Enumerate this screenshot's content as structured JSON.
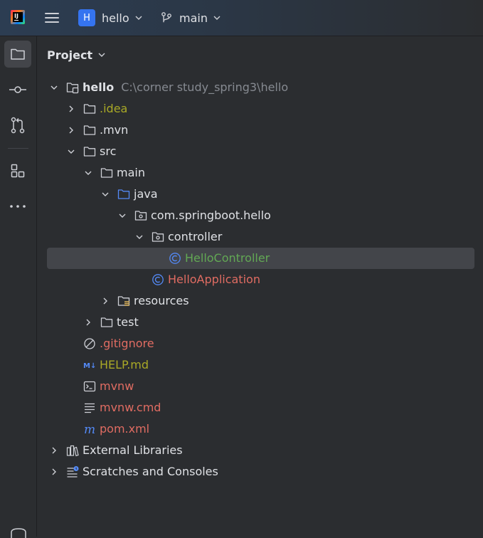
{
  "titlebar": {
    "logo_text": "IJ",
    "project_initial": "H",
    "project_name": "hello",
    "branch": "main",
    "accent": "#3574f0"
  },
  "toolstrip": {
    "items": [
      {
        "icon": "folder-icon",
        "label": "Project",
        "active": true
      },
      {
        "icon": "commit-icon",
        "label": "Commit"
      },
      {
        "icon": "pull-requests-icon",
        "label": "Pull Requests"
      },
      {
        "icon": "structure-icon",
        "label": "Structure"
      },
      {
        "icon": "more-icon",
        "label": "More"
      }
    ]
  },
  "panel": {
    "title": "Project"
  },
  "tree": [
    {
      "depth": 0,
      "expanded": true,
      "icon": "module-folder-icon",
      "label": "hello",
      "path": "C:\\corner study_spring3\\hello",
      "color": "default",
      "bold": true
    },
    {
      "depth": 1,
      "expanded": false,
      "icon": "folder-icon",
      "label": ".idea",
      "color": "yellow"
    },
    {
      "depth": 1,
      "expanded": false,
      "icon": "folder-icon",
      "label": ".mvn",
      "color": "default"
    },
    {
      "depth": 1,
      "expanded": true,
      "icon": "folder-icon",
      "label": "src",
      "color": "default"
    },
    {
      "depth": 2,
      "expanded": true,
      "icon": "folder-icon",
      "label": "main",
      "color": "default"
    },
    {
      "depth": 3,
      "expanded": true,
      "icon": "source-folder-icon",
      "label": "java",
      "color": "default"
    },
    {
      "depth": 4,
      "expanded": true,
      "icon": "package-icon",
      "label": "com.springboot.hello",
      "color": "default"
    },
    {
      "depth": 5,
      "expanded": true,
      "icon": "package-icon",
      "label": "controller",
      "color": "default"
    },
    {
      "depth": 6,
      "icon": "class-icon",
      "label": "HelloController",
      "color": "green",
      "selected": true
    },
    {
      "depth": 5,
      "icon": "class-icon",
      "label": "HelloApplication",
      "color": "red"
    },
    {
      "depth": 3,
      "expanded": false,
      "icon": "resources-folder-icon",
      "label": "resources",
      "color": "default"
    },
    {
      "depth": 2,
      "expanded": false,
      "icon": "folder-icon",
      "label": "test",
      "color": "default"
    },
    {
      "depth": 1,
      "icon": "gitignore-icon",
      "label": ".gitignore",
      "color": "red"
    },
    {
      "depth": 1,
      "icon": "markdown-icon",
      "label": "HELP.md",
      "color": "yellow"
    },
    {
      "depth": 1,
      "icon": "terminal-file-icon",
      "label": "mvnw",
      "color": "red"
    },
    {
      "depth": 1,
      "icon": "text-file-icon",
      "label": "mvnw.cmd",
      "color": "red"
    },
    {
      "depth": 1,
      "icon": "maven-icon",
      "label": "pom.xml",
      "color": "red"
    },
    {
      "depth": 0,
      "expanded": false,
      "icon": "libraries-icon",
      "label": "External Libraries",
      "color": "default"
    },
    {
      "depth": 0,
      "expanded": false,
      "icon": "scratches-icon",
      "label": "Scratches and Consoles",
      "color": "default"
    }
  ]
}
